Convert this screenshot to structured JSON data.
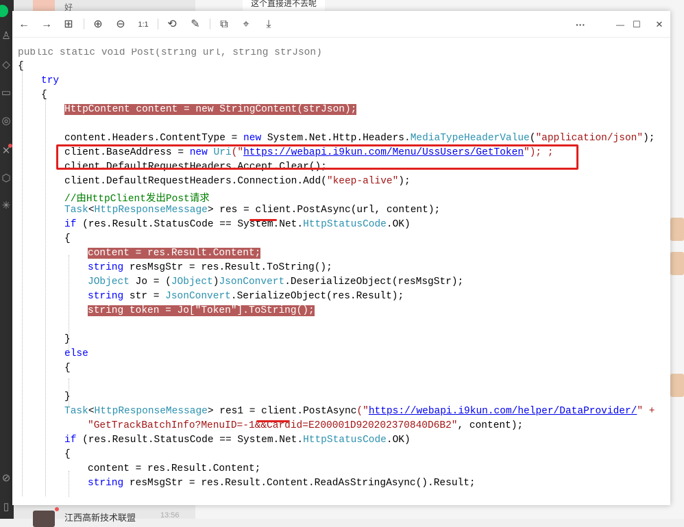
{
  "chat": {
    "top_preview": "好",
    "top_bubble": "这个直接进不去呢",
    "bottom_name": "江西高新技术联盟",
    "bottom_time": "13:56"
  },
  "toolbar": {
    "back": "←",
    "forward": "→",
    "grid": "⊞",
    "zoom_in": "⊕",
    "zoom_out": "⊖",
    "actual": "1:1",
    "rotate": "⟲",
    "edit": "✎",
    "copy": "⧉",
    "scan": "⌖",
    "download": "⤓",
    "more": "···",
    "minimize": "—",
    "maximize": "☐",
    "close": "✕"
  },
  "code": {
    "l0": "public static void Post(string url, string strJson)",
    "l1": "{",
    "l2": "try",
    "l3": "{",
    "l4": "HttpContent content = new StringContent(strJson);",
    "l5a": "content.Headers.ContentType = ",
    "l5b": "new",
    "l5c": " System.Net.Http.Headers.",
    "l5d": "MediaTypeHeaderValue",
    "l5e": "(",
    "l5f": "\"application/json\"",
    "l5g": ");",
    "l6a": "client.BaseAddress = ",
    "l6b": "new",
    "l6c": " ",
    "l6d": "Uri",
    "l6e": "(\"",
    "l6f": "https://webapi.i9kun.com/Menu/UssUsers/GetToken",
    "l6g": "\"); ;",
    "l7a": "client.DefaultRequestHeaders.Accept.",
    "l7b": "Clear",
    "l7c": "();",
    "l8a": "client.DefaultRequestHeaders.Connection.",
    "l8b": "Add",
    "l8c": "(",
    "l8d": "\"keep-alive\"",
    "l8e": ");",
    "l9": "//由HttpClient发出Post请求",
    "l10a": "Task",
    "l10b": "<",
    "l10c": "HttpResponseMessage",
    "l10d": "> res = client.",
    "l10e": "PostAsync",
    "l10f": "(url, content);",
    "l11a": "if",
    "l11b": " (res.Result.StatusCode == System.Net.",
    "l11c": "HttpStatusCode",
    "l11d": ".OK)",
    "l12": "{",
    "l13": "content = res.Result.Content;",
    "l14a": "string",
    "l14b": " resMsgStr = res.Result.",
    "l14c": "ToString",
    "l14d": "();",
    "l15a": "JObject",
    "l15b": " Jo = (",
    "l15c": "JObject",
    "l15d": ")",
    "l15e": "JsonConvert",
    "l15f": ".",
    "l15g": "DeserializeObject",
    "l15h": "(resMsgStr);",
    "l16a": "string",
    "l16b": " str = ",
    "l16c": "JsonConvert",
    "l16d": ".",
    "l16e": "SerializeObject",
    "l16f": "(res.Result);",
    "l17": "string token = Jo[\"Token\"].ToString();",
    "l18": "}",
    "l19": "else",
    "l20": "{",
    "l21": "}",
    "l22a": "Task",
    "l22b": "<",
    "l22c": "HttpResponseMessage",
    "l22d": "> res1 = client.",
    "l22e": "PostAsync",
    "l22f": "(\"",
    "l22g": "https://webapi.i9kun.com/helper/DataProvider/",
    "l22h": "\" +",
    "l23a": "\"GetTrackBatchInfo?MenuID=-1&&Cardid=E200001D920202370840D6B2\"",
    "l23b": ", content);",
    "l24a": "if",
    "l24b": " (res.Result.StatusCode == System.Net.",
    "l24c": "HttpStatusCode",
    "l24d": ".OK)",
    "l25": "{",
    "l26": "content = res.Result.Content;",
    "l27a": "string",
    "l27b": " resMsgStr = res.Result.Content.",
    "l27c": "ReadAsStringAsync",
    "l27d": "().Result;"
  }
}
